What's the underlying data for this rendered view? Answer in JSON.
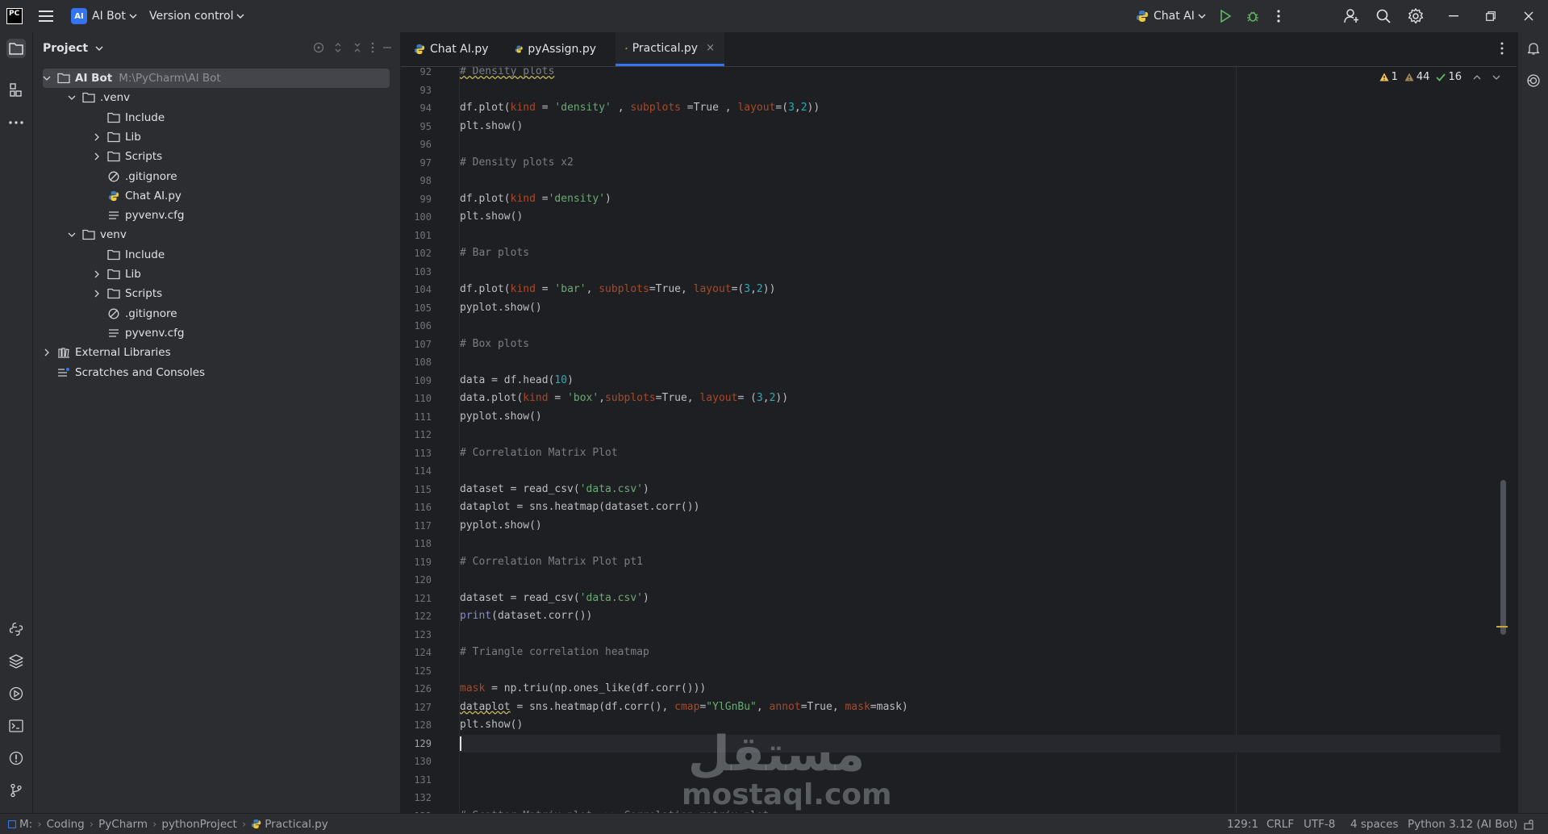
{
  "titlebar": {
    "project_badge": "AI",
    "project_name": "AI Bot",
    "version_control": "Version control",
    "run_config": "Chat AI"
  },
  "project_panel": {
    "title": "Project",
    "tree": [
      {
        "label": "AI Bot",
        "path": "M:\\PyCharm\\AI Bot",
        "type": "folder",
        "expanded": true,
        "depth": 0,
        "selected": true
      },
      {
        "label": ".venv",
        "type": "folder",
        "expanded": true,
        "depth": 1
      },
      {
        "label": "Include",
        "type": "folder",
        "depth": 2,
        "leaf": true
      },
      {
        "label": "Lib",
        "type": "folder",
        "depth": 2,
        "collapsed": true
      },
      {
        "label": "Scripts",
        "type": "folder",
        "depth": 2,
        "collapsed": true
      },
      {
        "label": ".gitignore",
        "type": "ignore",
        "depth": 2,
        "leaf": true
      },
      {
        "label": "Chat AI.py",
        "type": "python",
        "depth": 2,
        "leaf": true
      },
      {
        "label": "pyvenv.cfg",
        "type": "cfg",
        "depth": 2,
        "leaf": true
      },
      {
        "label": "venv",
        "type": "folder",
        "expanded": true,
        "depth": 1
      },
      {
        "label": "Include",
        "type": "folder",
        "depth": 2,
        "leaf": true
      },
      {
        "label": "Lib",
        "type": "folder",
        "depth": 2,
        "collapsed": true
      },
      {
        "label": "Scripts",
        "type": "folder",
        "depth": 2,
        "collapsed": true
      },
      {
        "label": ".gitignore",
        "type": "ignore",
        "depth": 2,
        "leaf": true
      },
      {
        "label": "pyvenv.cfg",
        "type": "cfg",
        "depth": 2,
        "leaf": true
      },
      {
        "label": "External Libraries",
        "type": "library",
        "depth": 0,
        "collapsed": true
      },
      {
        "label": "Scratches and Consoles",
        "type": "scratches",
        "depth": 0,
        "leaf": true
      }
    ]
  },
  "tabs": [
    {
      "label": "Chat AI.py",
      "active": false
    },
    {
      "label": "pyAssign.py",
      "active": false
    },
    {
      "label": "Practical.py",
      "active": true,
      "close": "×"
    }
  ],
  "inspections": {
    "warnings_strong": "1",
    "warnings_weak": "44",
    "ok": "16"
  },
  "code": {
    "first_line": 92,
    "current_line": 129,
    "lines": [
      "# Density plots",
      "",
      "df.plot(kind = 'density' , subplots =True , layout=(3,2))",
      "plt.show()",
      "",
      "# Density plots x2",
      "",
      "df.plot(kind ='density')",
      "plt.show()",
      "",
      "# Bar plots",
      "",
      "df.plot(kind = 'bar', subplots=True, layout=(3,2))",
      "pyplot.show()",
      "",
      "# Box plots",
      "",
      "data = df.head(10)",
      "data.plot(kind = 'box',subplots=True, layout= (3,2))",
      "pyplot.show()",
      "",
      "# Correlation Matrix Plot",
      "",
      "dataset = read_csv('data.csv')",
      "dataplot = sns.heatmap(dataset.corr())",
      "pyplot.show()",
      "",
      "# Correlation Matrix Plot pt1",
      "",
      "dataset = read_csv('data.csv')",
      "print(dataset.corr())",
      "",
      "# Triangle correlation heatmap",
      "",
      "mask = np.triu(np.ones_like(df.corr()))",
      "dataplot = sns.heatmap(df.corr(), cmap=\"YlGnBu\", annot=True, mask=mask)",
      "plt.show()",
      "",
      "",
      "",
      "",
      "# Scatter Matrix plot ->> Correlation matrix plot"
    ]
  },
  "watermark": {
    "arabic": "مستقل",
    "latin": "mostaql.com"
  },
  "statusbar": {
    "breadcrumbs": [
      "M:",
      "Coding",
      "PyCharm",
      "pythonProject",
      "Practical.py"
    ],
    "position": "129:1",
    "line_ending": "CRLF",
    "encoding": "UTF-8",
    "indent": "4 spaces",
    "interpreter": "Python 3.12 (AI Bot)"
  },
  "colors": {
    "accent": "#3574f0",
    "background": "#1e1f22",
    "panel": "#2b2d30",
    "comment": "#7a7e85",
    "string": "#6aab73",
    "keyword_arg": "#aa4926",
    "number": "#2aacb8"
  }
}
